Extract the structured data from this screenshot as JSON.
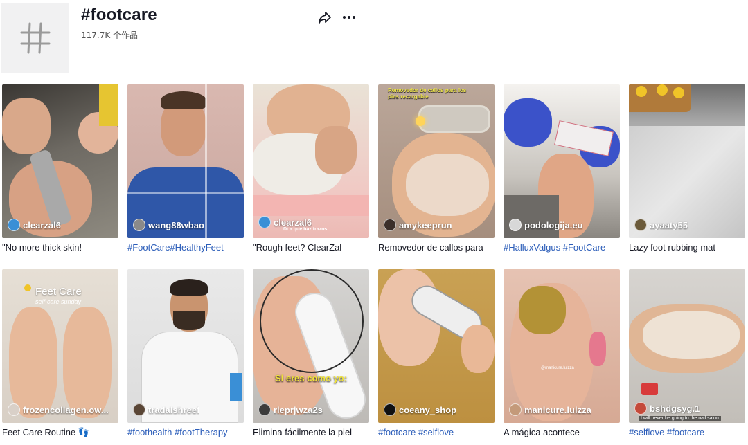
{
  "header": {
    "title": "#footcare",
    "count": "117.7K 个作品"
  },
  "cards": [
    {
      "author": "clearzal6",
      "caption": "\"No more thick skin!",
      "caption_is_tag": false,
      "avatar_color": "#3a8fd6"
    },
    {
      "author": "wang88wbao",
      "caption": "#FootCare#HealthyFeet",
      "caption_is_tag": true,
      "avatar_color": "#8a8a8a"
    },
    {
      "author": "clearzal6",
      "caption": "\"Rough feet? ClearZal",
      "caption_is_tag": false,
      "avatar_color": "#3a8fd6",
      "overlay_sub": "Di a que haz trazos"
    },
    {
      "author": "amykeeprun",
      "caption": "Removedor de callos para",
      "caption_is_tag": false,
      "avatar_color": "#3b2f2a",
      "overlay_top": "Removedor de callos para los pies recargable"
    },
    {
      "author": "podologija.eu",
      "caption": "#HalluxValgus #FootCare",
      "caption_is_tag": true,
      "avatar_color": "#d8d8d8"
    },
    {
      "author": "ayaaty55",
      "caption": "Lazy foot rubbing mat",
      "caption_is_tag": false,
      "avatar_color": "#6b5a3a"
    },
    {
      "author": "frozencollagen.ow...",
      "caption": "Feet Care Routine 👣",
      "caption_is_tag": false,
      "avatar_color": "#d9d0c8",
      "overlay_title": "Feet Care",
      "overlay_sub": "self-care sunday"
    },
    {
      "author": "tradalshreef",
      "caption": "#foothealth #footTherapy",
      "caption_is_tag": true,
      "avatar_color": "#5a4636"
    },
    {
      "author": "rieprjwza2s",
      "caption": "Elimina fácilmente la piel",
      "caption_is_tag": false,
      "avatar_color": "#3c3c3c",
      "overlay_title": "Si eres como yo:"
    },
    {
      "author": "coeany_shop",
      "caption": "#footcare #selflove",
      "caption_is_tag": true,
      "avatar_color": "#111111"
    },
    {
      "author": "manicure.luizza",
      "caption": "A mágica acontece",
      "caption_is_tag": false,
      "avatar_color": "#c49a7a",
      "overlay_sub": "@manicure.luizza"
    },
    {
      "author": "bshdgsyg.1",
      "caption": "#selflove #footcare",
      "caption_is_tag": true,
      "avatar_color": "#c44a3a",
      "overlay_bottom": "I will never be going to the nail salon"
    }
  ]
}
